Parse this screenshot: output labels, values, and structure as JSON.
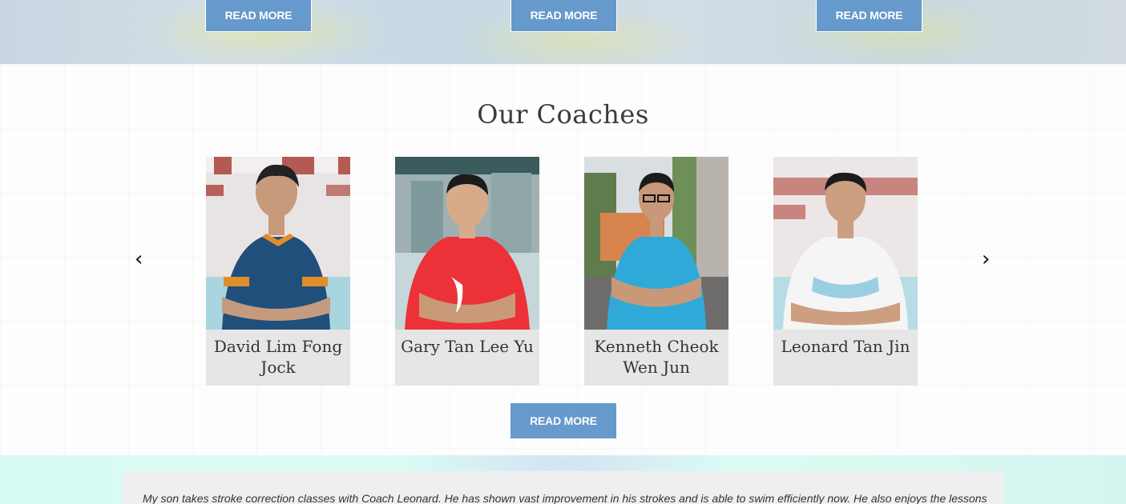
{
  "top": {
    "buttons": [
      {
        "label": "READ MORE"
      },
      {
        "label": "READ MORE"
      },
      {
        "label": "READ MORE"
      }
    ]
  },
  "coaches": {
    "title": "Our Coaches",
    "prev_arrow": "‹",
    "next_arrow": "›",
    "items": [
      {
        "name": "David Lim Fong Jock",
        "shirt": "dark-blue",
        "bg": "building"
      },
      {
        "name": "Gary Tan Lee Yu",
        "shirt": "red",
        "bg": "pool"
      },
      {
        "name": "Kenneth Cheok Wen Jun",
        "shirt": "cyan",
        "bg": "outdoor"
      },
      {
        "name": "Leonard Tan Jin",
        "shirt": "white",
        "bg": "building"
      }
    ],
    "read_more": "READ MORE"
  },
  "testimonial": {
    "text": "My son takes stroke correction classes with Coach Leonard. He has shown vast improvement in his strokes and is able to swim efficiently now. He also enjoys the lessons"
  },
  "colors": {
    "button": "#6699cc",
    "card": "#e6e6e6",
    "title": "#3b3b3b",
    "accent_band": "#d6fbf3"
  }
}
